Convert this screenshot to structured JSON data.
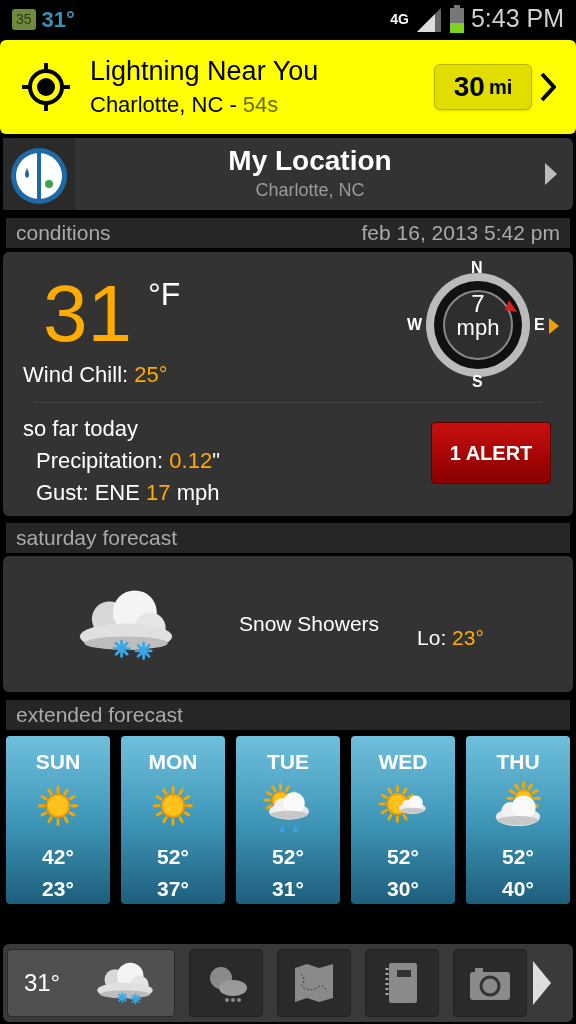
{
  "status_bar": {
    "badge": "35",
    "temperature": "31°",
    "network": "4G",
    "time": "5:43 PM"
  },
  "lightning_banner": {
    "title": "Lightning Near You",
    "location": "Charlotte, NC - ",
    "age": "54s",
    "distance": "30",
    "unit": "mi"
  },
  "location": {
    "title": "My Location",
    "subtitle": "Charlotte, NC"
  },
  "conditions": {
    "header": "conditions",
    "timestamp": "feb 16, 2013 5:42 pm",
    "temperature": "31",
    "unit": "°F",
    "wind_chill": {
      "label": "Wind Chill: ",
      "value": "25°"
    },
    "wind": {
      "speed": "7",
      "unit": "mph",
      "north": "N",
      "south": "S",
      "east": "E",
      "west": "W"
    },
    "today_heading": "so far today",
    "today": [
      {
        "label": "Precipitation: ",
        "value": "0.12",
        "suffix": "\""
      },
      {
        "label": "Gust: ENE ",
        "value": "17",
        "suffix": " mph"
      }
    ],
    "alert_button": "1 ALERT"
  },
  "saturday_forecast": {
    "header": "saturday forecast",
    "description": "Snow Showers",
    "low_label": "Lo: ",
    "low": "23°"
  },
  "extended_forecast": {
    "header": "extended forecast",
    "days": [
      {
        "day": "SUN",
        "kind": "sun",
        "high": "42°",
        "low": "23°"
      },
      {
        "day": "MON",
        "kind": "sun",
        "high": "52°",
        "low": "37°"
      },
      {
        "day": "TUE",
        "kind": "sun_rain",
        "high": "52°",
        "low": "31°"
      },
      {
        "day": "WED",
        "kind": "sun_cloud",
        "high": "52°",
        "low": "30°"
      },
      {
        "day": "THU",
        "kind": "cloud_sun",
        "high": "52°",
        "low": "40°"
      }
    ]
  },
  "bottom_nav": {
    "temperature": "31°",
    "tabs": [
      {
        "kind": "current",
        "selected": true
      },
      {
        "kind": "forecast",
        "selected": false
      },
      {
        "kind": "map",
        "selected": false
      },
      {
        "kind": "notebook",
        "selected": false
      },
      {
        "kind": "camera",
        "selected": false
      }
    ]
  }
}
